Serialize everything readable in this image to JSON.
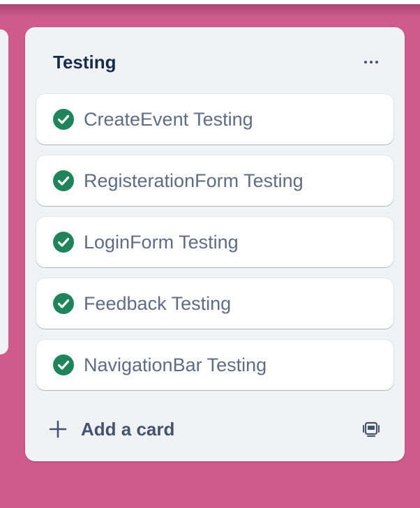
{
  "list": {
    "title": "Testing",
    "more_icon": "more-horizontal-icon",
    "cards": [
      {
        "title": "CreateEvent Testing",
        "status": "complete",
        "icon": "check-circle-icon"
      },
      {
        "title": "RegisterationForm Testing",
        "status": "complete",
        "icon": "check-circle-icon"
      },
      {
        "title": "LoginForm Testing",
        "status": "complete",
        "icon": "check-circle-icon"
      },
      {
        "title": "Feedback Testing",
        "status": "complete",
        "icon": "check-circle-icon"
      },
      {
        "title": "NavigationBar Testing",
        "status": "complete",
        "icon": "check-circle-icon"
      }
    ],
    "add_card_label": "Add a card",
    "add_icon": "plus-icon",
    "template_icon": "card-template-icon"
  },
  "colors": {
    "board_background": "#cf5b8c",
    "list_background": "#f1f2f4",
    "card_background": "#ffffff",
    "check_green": "#1f845a",
    "title_text": "#172b4d",
    "card_text": "#5e6c84"
  }
}
